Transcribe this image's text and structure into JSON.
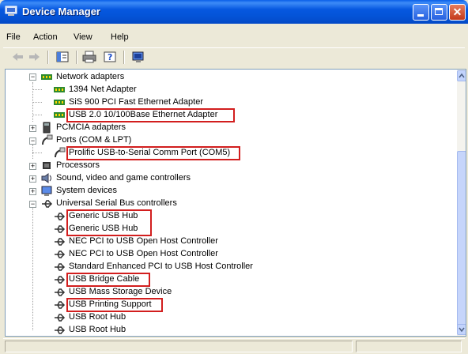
{
  "window": {
    "title": "Device Manager"
  },
  "menu": [
    "File",
    "Action",
    "View",
    "Help"
  ],
  "toolbar": {
    "icons": [
      "back-icon",
      "forward-icon",
      "properties-icon",
      "print-icon",
      "help-icon",
      "scan-hardware-icon"
    ]
  },
  "tree": {
    "network_adapters": "Network adapters",
    "adapter_1394": "1394 Net Adapter",
    "adapter_sis": "SiS 900 PCI Fast Ethernet Adapter",
    "adapter_usb": "USB 2.0 10/100Base Ethernet Adapter",
    "pcmcia": "PCMCIA adapters",
    "ports": "Ports (COM & LPT)",
    "prolific": "Prolific USB-to-Serial Comm Port (COM5)",
    "processors": "Processors",
    "sound": "Sound, video and game controllers",
    "system_devices": "System devices",
    "usb_controllers": "Universal Serial Bus controllers",
    "usb_children": [
      "Generic USB Hub",
      "Generic USB Hub",
      "NEC PCI to USB Open Host Controller",
      "NEC PCI to USB Open Host Controller",
      "Standard Enhanced PCI to USB Host Controller",
      "USB Bridge Cable",
      "USB Mass Storage Device",
      "USB Printing Support",
      "USB Root Hub",
      "USB Root Hub"
    ]
  },
  "colors": {
    "title_blue": "#0453D6",
    "highlight_red": "#D21E1E"
  }
}
